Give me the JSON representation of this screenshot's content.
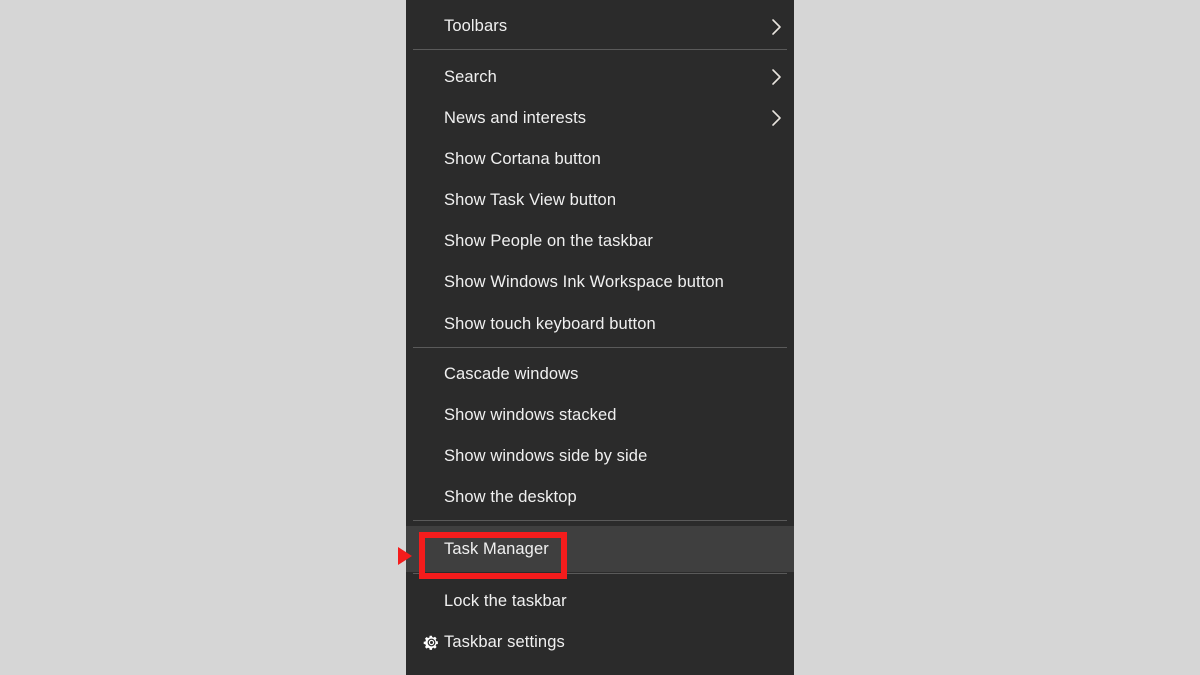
{
  "window": {
    "type": "taskbar-context-menu",
    "background_color": "#d6d6d6",
    "menu_background_color": "#2b2b2b",
    "hover_background_color": "#3f3f3f",
    "text_color": "#f0f0f0",
    "separator_color": "#5a5a5a",
    "accent_color": "#f41c1c"
  },
  "menu": {
    "groups": [
      {
        "items": [
          {
            "label": "Toolbars",
            "submenu": true,
            "icon": "chevron-right-icon",
            "hovered": false
          }
        ]
      },
      {
        "items": [
          {
            "label": "Search",
            "submenu": true,
            "icon": "chevron-right-icon",
            "hovered": false
          },
          {
            "label": "News and interests",
            "submenu": true,
            "icon": "chevron-right-icon",
            "hovered": false
          },
          {
            "label": "Show Cortana button",
            "submenu": false,
            "icon": null,
            "hovered": false
          },
          {
            "label": "Show Task View button",
            "submenu": false,
            "icon": null,
            "hovered": false
          },
          {
            "label": "Show People on the taskbar",
            "submenu": false,
            "icon": null,
            "hovered": false
          },
          {
            "label": "Show Windows Ink Workspace button",
            "submenu": false,
            "icon": null,
            "hovered": false
          },
          {
            "label": "Show touch keyboard button",
            "submenu": false,
            "icon": null,
            "hovered": false
          }
        ]
      },
      {
        "items": [
          {
            "label": "Cascade windows",
            "submenu": false,
            "icon": null,
            "hovered": false
          },
          {
            "label": "Show windows stacked",
            "submenu": false,
            "icon": null,
            "hovered": false
          },
          {
            "label": "Show windows side by side",
            "submenu": false,
            "icon": null,
            "hovered": false
          },
          {
            "label": "Show the desktop",
            "submenu": false,
            "icon": null,
            "hovered": false
          }
        ]
      },
      {
        "items": [
          {
            "label": "Task Manager",
            "submenu": false,
            "icon": null,
            "hovered": true
          }
        ]
      },
      {
        "items": [
          {
            "label": "Lock the taskbar",
            "submenu": false,
            "icon": null,
            "hovered": false
          },
          {
            "label": "Taskbar settings",
            "submenu": false,
            "icon": "gear-icon",
            "hovered": false
          }
        ]
      }
    ]
  },
  "annotation": {
    "highlight_target": "Task Manager",
    "highlight_color": "#f41c1c",
    "arrow": "right-pointing-triangle"
  }
}
